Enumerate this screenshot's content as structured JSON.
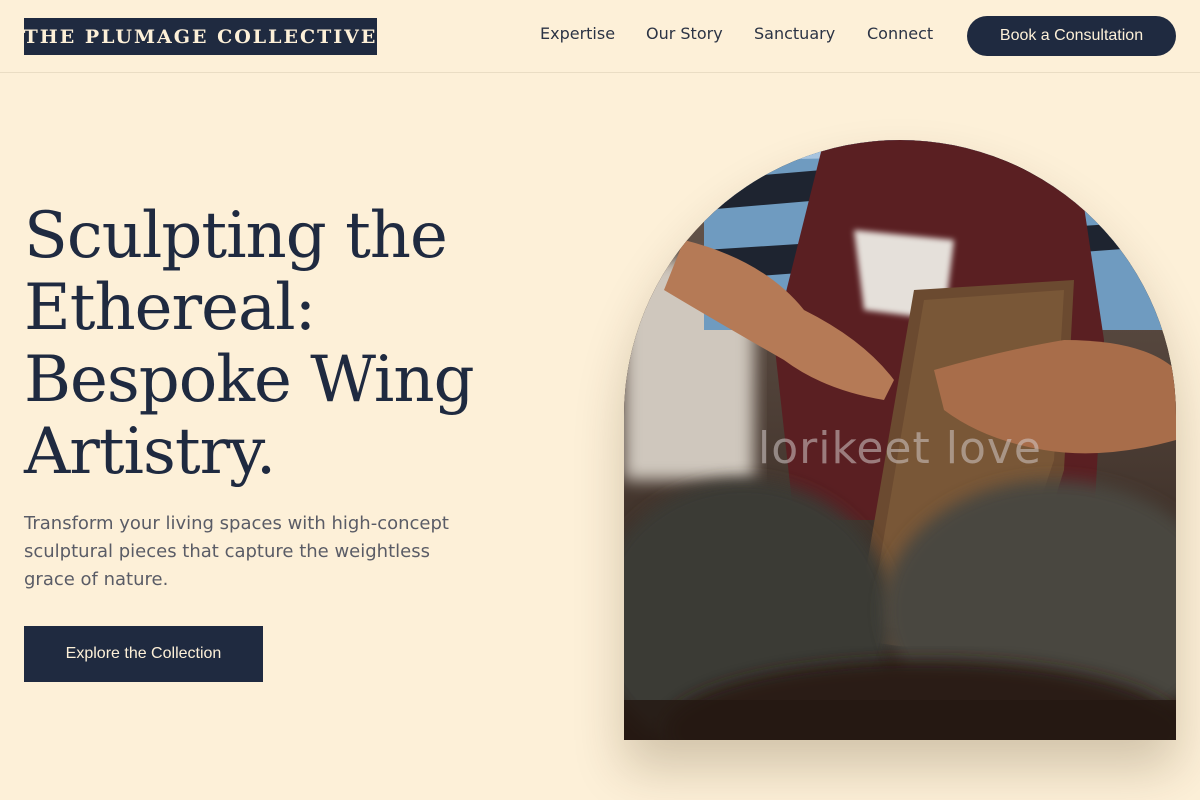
{
  "header": {
    "logo": "THE PLUMAGE COLLECTIVE",
    "nav": [
      "Expertise",
      "Our Story",
      "Sanctuary",
      "Connect"
    ],
    "cta": "Book a Consultation"
  },
  "hero": {
    "title_lines": [
      "Sculpting the",
      "Ethereal:",
      "Bespoke Wing",
      "Artistry."
    ],
    "subtitle": "Transform your living spaces with high-concept sculptural pieces that capture the weightless grace of nature.",
    "cta": "Explore the Collection"
  },
  "image": {
    "watermark": "lorikeet love",
    "subject": "artisan hands carving wood"
  },
  "colors": {
    "background": "#fdf0d8",
    "navy": "#1f2a40",
    "body_text": "#5a5c66"
  }
}
